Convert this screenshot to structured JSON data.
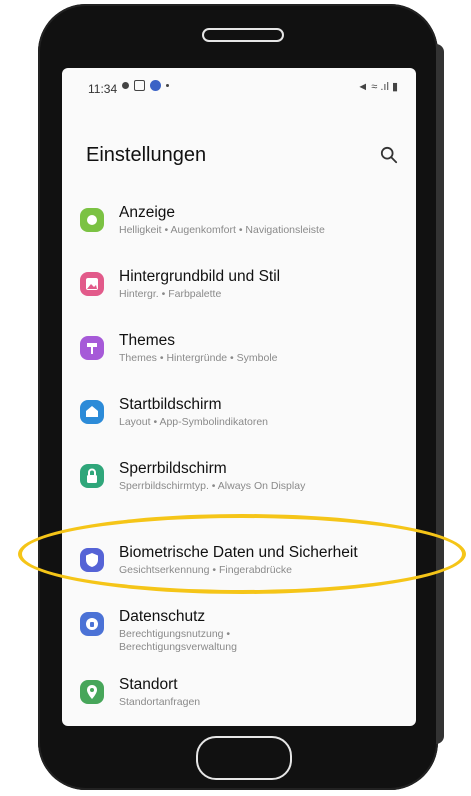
{
  "status_bar": {
    "time": "11:34",
    "right_text": "◄ ≈ .ıl ▮"
  },
  "header": {
    "title": "Einstellungen"
  },
  "items": [
    {
      "title": "Anzeige",
      "subtitle": "Helligkeit  •  Augenkomfort  •  Navigationsleiste",
      "icon": "display-icon",
      "color": "#7bc243"
    },
    {
      "title": "Hintergrundbild und Stil",
      "subtitle": "Hintergr.  •  Farbpalette",
      "icon": "wallpaper-icon",
      "color": "#e25a8a"
    },
    {
      "title": "Themes",
      "subtitle": "Themes  •  Hintergründe  •  Symbole",
      "icon": "themes-icon",
      "color": "#a65ad8"
    },
    {
      "title": "Startbildschirm",
      "subtitle": "Layout  •  App-Symbolindikatoren",
      "icon": "home-screen-icon",
      "color": "#2c8bd8"
    },
    {
      "title": "Sperrbildschirm",
      "subtitle": "Sperrbildschirmtyp.  •  Always On Display",
      "icon": "lock-icon",
      "color": "#2fa67a"
    },
    {
      "title": "Biometrische Daten und Sicherheit",
      "subtitle": "Gesichtserkennung  •  Fingerabdrücke",
      "icon": "shield-icon",
      "color": "#5563d6"
    },
    {
      "title": "Datenschutz",
      "subtitle": "Berechtigungsnutzung  •\nBerechtigungsverwaltung",
      "icon": "privacy-icon",
      "color": "#4b72d6"
    },
    {
      "title": "Standort",
      "subtitle": "Standortanfragen",
      "icon": "location-icon",
      "color": "#47a65a"
    }
  ],
  "colors": {
    "highlight": "#f5c518"
  }
}
